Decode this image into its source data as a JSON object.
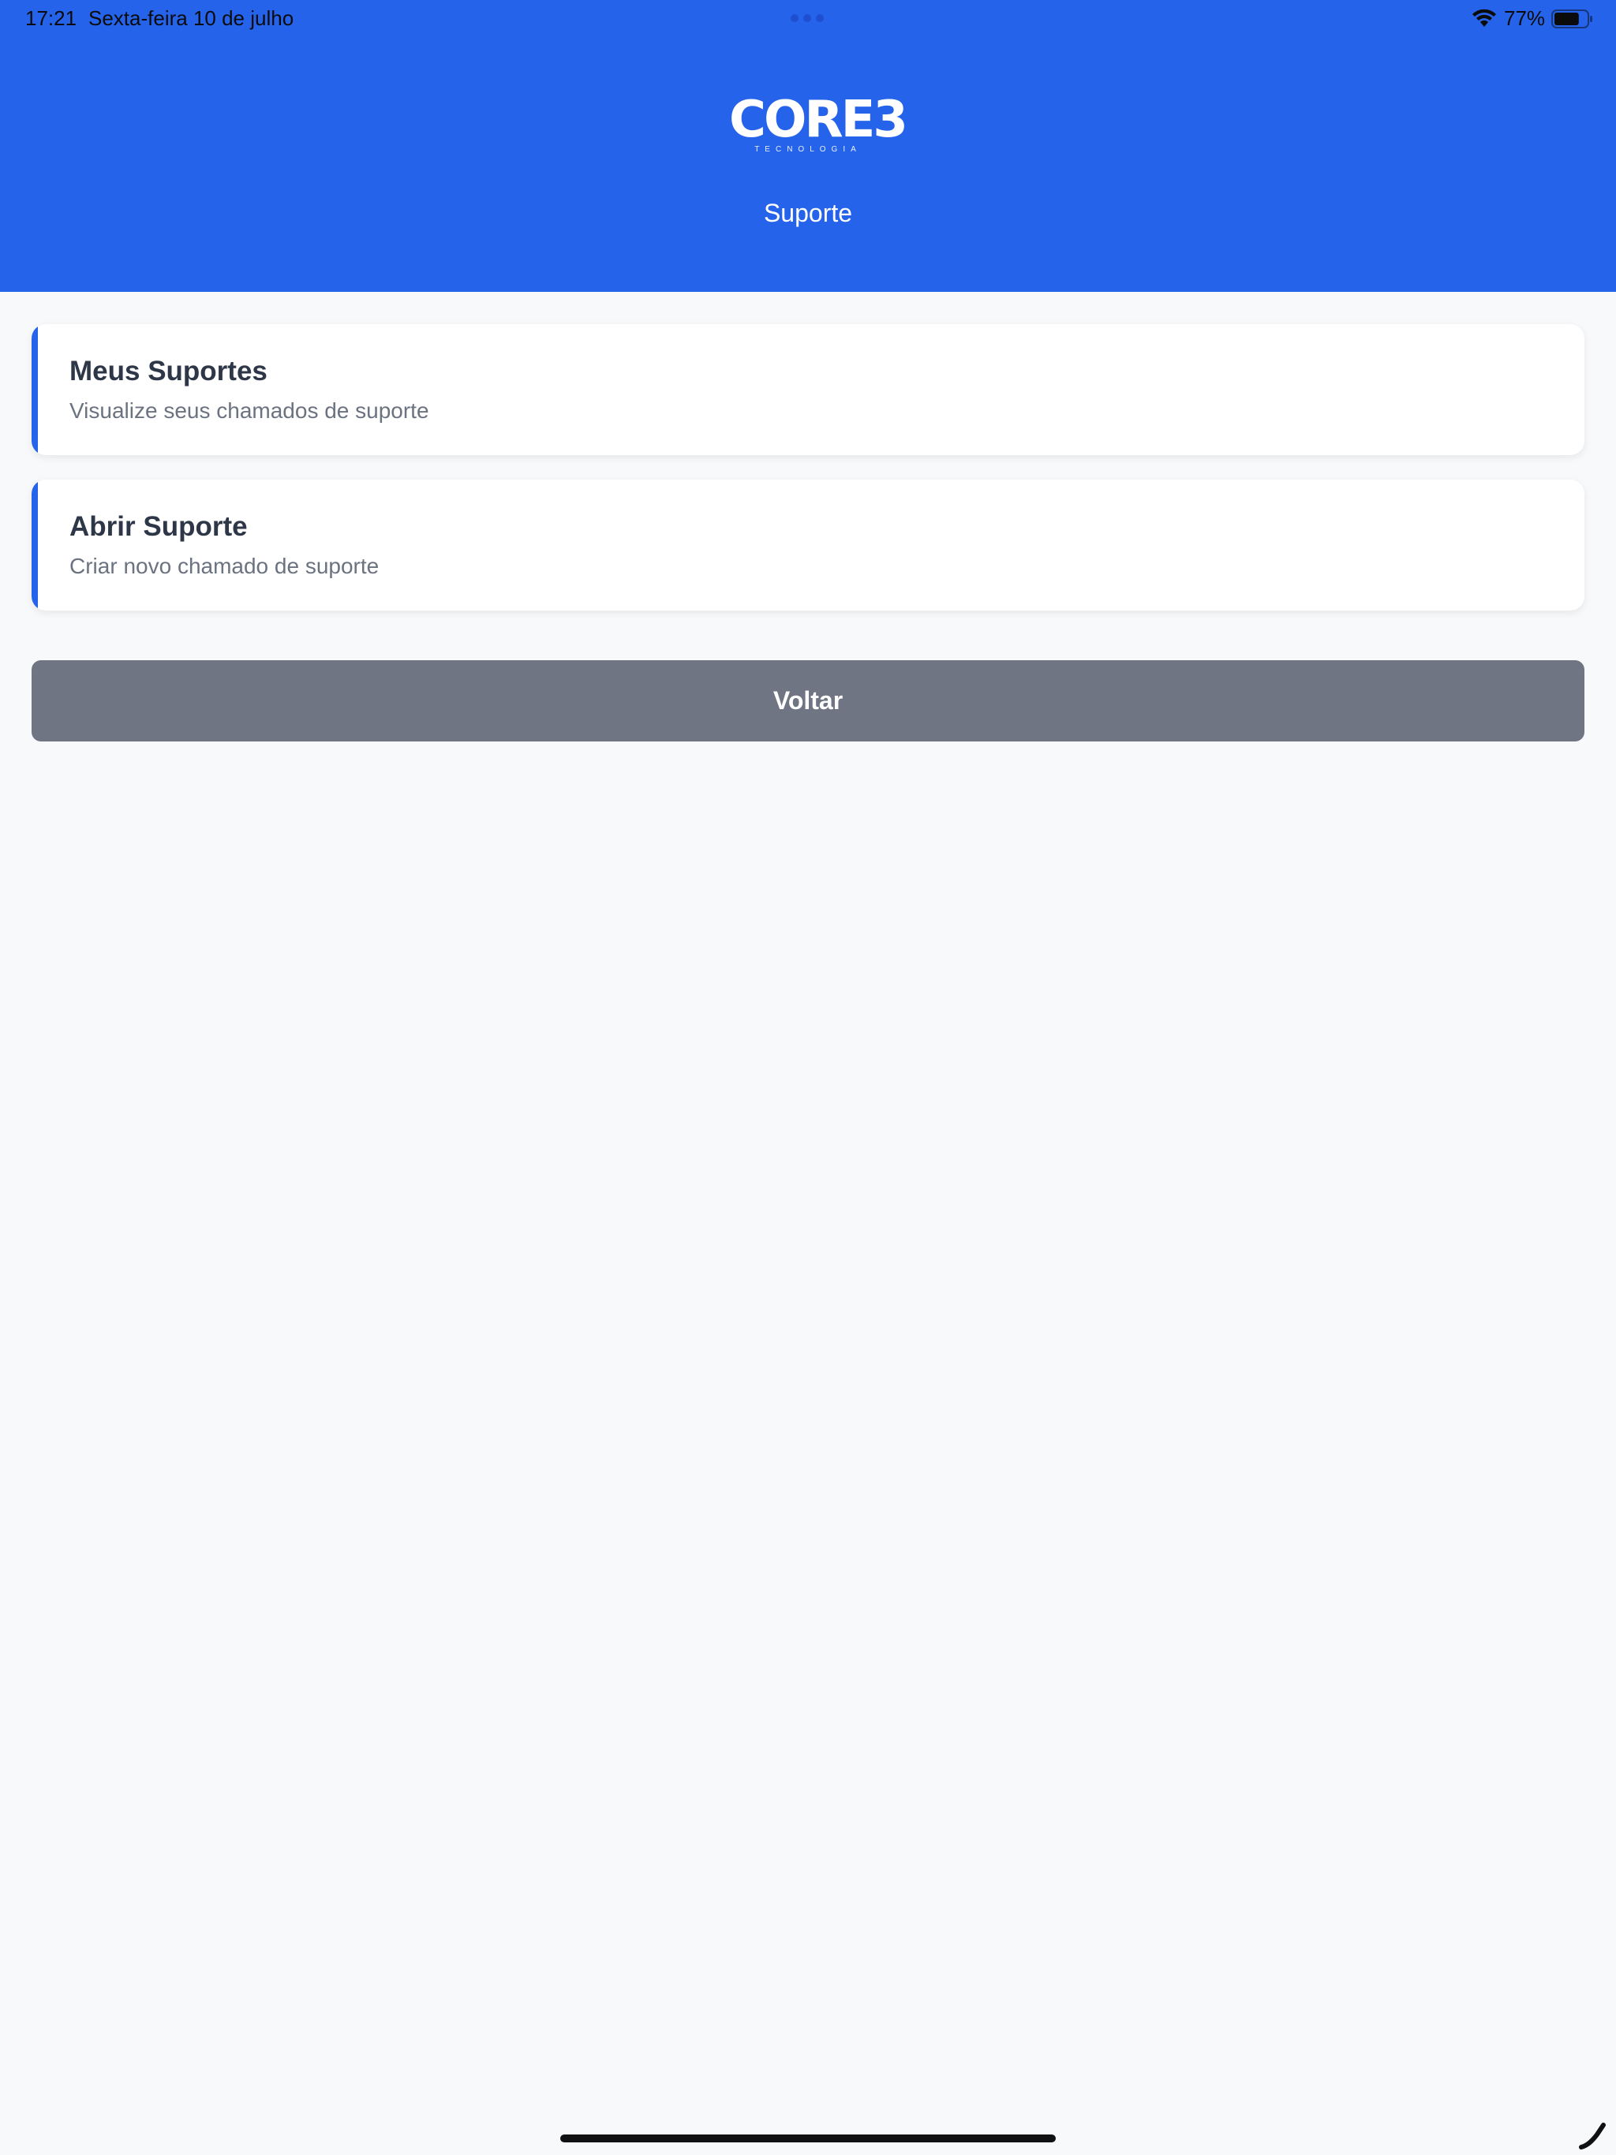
{
  "status_bar": {
    "time": "17:21",
    "date": "Sexta-feira 10 de julho",
    "battery_percent": "77%",
    "battery_level": 0.77,
    "icons": [
      "wifi-icon",
      "battery-icon",
      "more-dots-icon"
    ]
  },
  "header": {
    "logo_text": "CORE3",
    "logo_subtext": "TECNOLOGIA",
    "title": "Suporte",
    "background_color": "#2563eb"
  },
  "menu": {
    "items": [
      {
        "title": "Meus Suportes",
        "subtitle": "Visualize seus chamados de suporte"
      },
      {
        "title": "Abrir Suporte",
        "subtitle": "Criar novo chamado de suporte"
      }
    ],
    "accent_color": "#2563eb"
  },
  "actions": {
    "back_label": "Voltar",
    "back_color": "#6f7582"
  }
}
